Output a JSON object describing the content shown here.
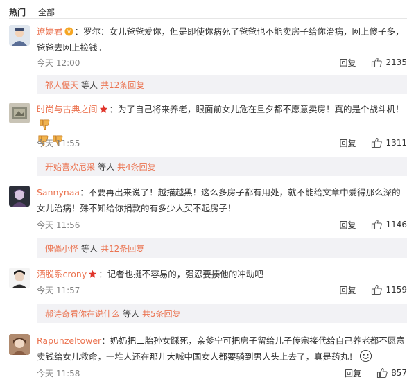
{
  "tabs": {
    "hot": "热门",
    "all": "全部"
  },
  "comments": [
    {
      "user": "遼婕君",
      "text": "：罗尔：女儿爸爸爱你，但是即使你病死了爸爸也不能卖房子给你治病，网上傻子多，爸爸去网上捡钱。",
      "time": "今天 12:00",
      "reply": "回复",
      "likes": "2135",
      "sub": {
        "name": "祁人優天",
        "others": "等人",
        "link": "共12条回复"
      }
    },
    {
      "user": "时尚与古典之间",
      "text": "：为了自己将来养老，眼面前女儿危在旦夕都不愿意卖房！真的是个战斗机！",
      "time": "今天 11:55",
      "reply": "回复",
      "likes": "1311",
      "sub": {
        "name": "开始喜欢尼采",
        "others": "等人",
        "link": "共4条回复"
      }
    },
    {
      "user": "Sannynaa",
      "text": "：不要再出来说了！越描越黑！这么多房子都有用处，就不能给文章中爱得那么深的女儿治病！殊不知给你捐款的有多少人买不起房子！",
      "time": "今天 11:56",
      "reply": "回复",
      "likes": "1146",
      "sub": {
        "name": "傀儡小怪",
        "others": "等人",
        "link": "共12条回复"
      }
    },
    {
      "user": "洒脱系crony",
      "text": "：记者也挺不容易的，强忍要揍他的冲动吧",
      "time": "今天 11:57",
      "reply": "回复",
      "likes": "1159",
      "sub": {
        "name": "郝诗奇看你在说什么",
        "others": "等人",
        "link": "共5条回复"
      }
    },
    {
      "user": "Rapunzeltower",
      "text": "：奶奶把二胎孙女踩死，亲爹宁可把房子留给儿子传宗接代给自己养老都不愿意卖钱给女儿救命，一堆人还在那儿大喊中国女人都要骑到男人头上去了，真是药丸！",
      "time": "今天 11:58",
      "reply": "回复",
      "likes": "857"
    }
  ],
  "colors": {
    "username": "#eb7350",
    "subbox_bg": "#f2f2f5",
    "meta": "#808080"
  },
  "icons": [
    "thumbs-up-icon",
    "vip-badge-icon",
    "star-badge-icon",
    "thumbs-down-emoji-icon",
    "smile-emoji-icon"
  ]
}
